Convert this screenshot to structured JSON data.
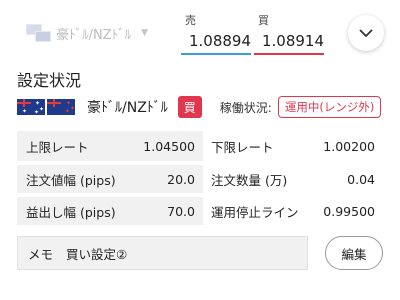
{
  "header": {
    "pair_selector_label": "豪ﾄﾞﾙ/NZﾄﾞﾙ",
    "sell": {
      "label": "売",
      "value": "1.08894"
    },
    "buy": {
      "label": "買",
      "value": "1.08914"
    },
    "collapse_icon": "chevron-down-icon"
  },
  "section": {
    "title": "設定状況",
    "pair_name": "豪ﾄﾞﾙ/NZﾄﾞﾙ",
    "side_badge": "買",
    "status_label": "稼働状況:",
    "status_value": "運用中(レンジ外)"
  },
  "table": {
    "rows": [
      {
        "label1": "上限レート",
        "value1": "1.04500",
        "label2": "下限レート",
        "value2": "1.00200"
      },
      {
        "label1": "注文値幅 (pips)",
        "value1": "20.0",
        "label2": "注文数量 (万)",
        "value2": "0.04"
      },
      {
        "label1": "益出し幅 (pips)",
        "value1": "70.0",
        "label2": "運用停止ライン",
        "value2": "0.99500"
      }
    ]
  },
  "memo": {
    "label": "メモ",
    "value": "買い設定②"
  },
  "edit_button": "編集",
  "colors": {
    "buy_red": "#e0374f",
    "sell_blue": "#3a9be0",
    "table_bg": "#f1f1f1"
  }
}
